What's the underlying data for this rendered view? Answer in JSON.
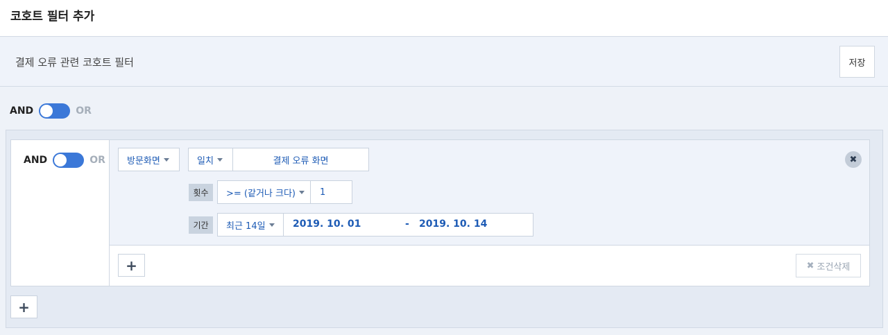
{
  "header": {
    "title": "코호트 필터 추가"
  },
  "filter_name": {
    "title": "결제 오류 관련 코호트 필터",
    "save_label": "저장"
  },
  "top_toggle": {
    "and_label": "AND",
    "or_label": "OR"
  },
  "group_toggle": {
    "and_label": "AND",
    "or_label": "OR"
  },
  "condition": {
    "event_type": "방문화면",
    "match_type": "일치",
    "match_value": "결제 오류 화면",
    "count_label": "횟수",
    "count_operator": ">= (같거나 크다)",
    "count_value": "1",
    "period_label": "기간",
    "period_preset": "최근 14일",
    "date_start": "2019. 10. 01",
    "date_separator": "-",
    "date_end": "2019. 10. 14"
  },
  "actions": {
    "remove_icon": "close-icon",
    "add_condition_icon": "plus-icon",
    "delete_condition_label": "조건삭제",
    "add_group_icon": "plus-icon"
  },
  "colors": {
    "accent": "#3b78d8",
    "link": "#1d5bb5",
    "panel": "#eff3fa"
  }
}
